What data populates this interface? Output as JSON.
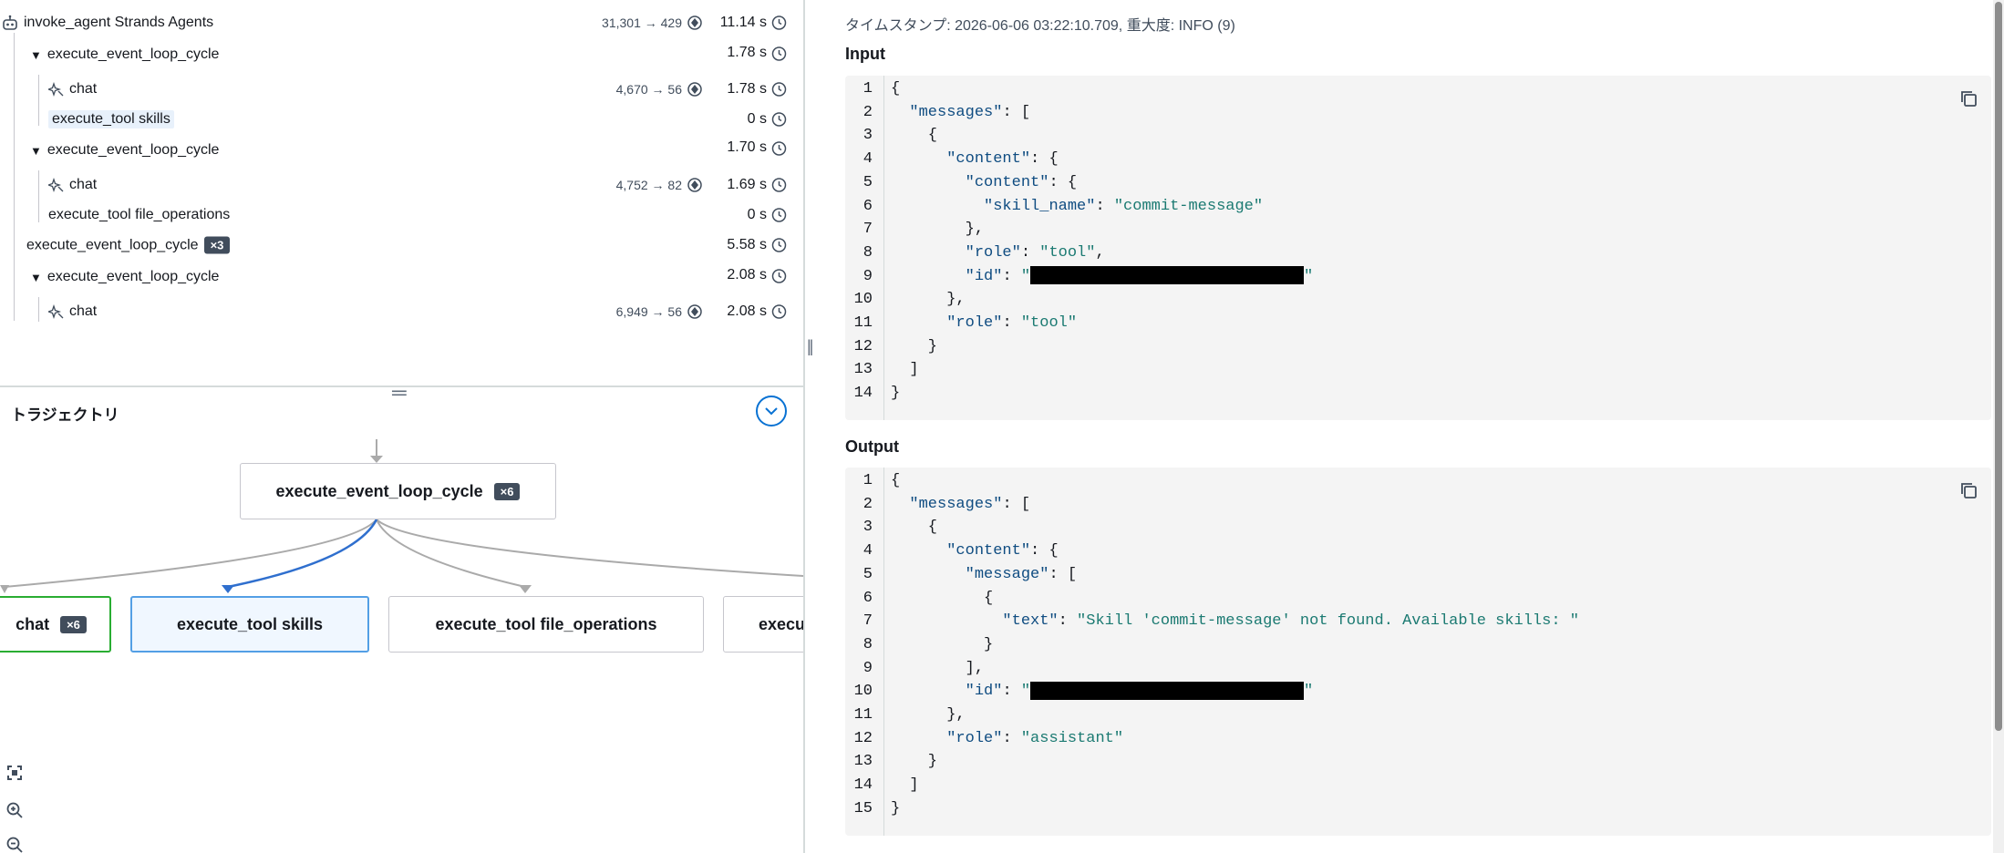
{
  "trace": {
    "rows": [
      {
        "label": "invoke_agent Strands Agents",
        "tokens": "31,301 → 429",
        "duration": "11.14 s"
      },
      {
        "label": "execute_event_loop_cycle",
        "duration": "1.78 s"
      },
      {
        "label": "chat",
        "tokens": "4,670 → 56",
        "duration": "1.78 s"
      },
      {
        "label": "execute_tool skills",
        "duration": "0 s"
      },
      {
        "label": "execute_event_loop_cycle",
        "duration": "1.70 s"
      },
      {
        "label": "chat",
        "tokens": "4,752 → 82",
        "duration": "1.69 s"
      },
      {
        "label": "execute_tool file_operations",
        "duration": "0 s"
      },
      {
        "label": "execute_event_loop_cycle",
        "badge": "×3",
        "duration": "5.58 s"
      },
      {
        "label": "execute_event_loop_cycle",
        "duration": "2.08 s"
      },
      {
        "label": "chat",
        "tokens": "6,949 → 56",
        "duration": "2.08 s"
      }
    ]
  },
  "trajectory": {
    "title": "トラジェクトリ",
    "root": {
      "label": "execute_event_loop_cycle",
      "badge": "×6"
    },
    "children": [
      {
        "label": "chat",
        "badge": "×6"
      },
      {
        "label": "execute_tool skills"
      },
      {
        "label": "execute_tool file_operations"
      },
      {
        "label": "execu"
      }
    ]
  },
  "detail": {
    "timestamp": "タイムスタンプ: 2026-06-06 03:22:10.709, 重大度: INFO (9)",
    "input_title": "Input",
    "output_title": "Output"
  },
  "input_code": [
    {
      "n": "1",
      "parts": [
        {
          "t": "p",
          "v": "{"
        }
      ]
    },
    {
      "n": "2",
      "parts": [
        {
          "t": "p",
          "v": "  "
        },
        {
          "t": "k",
          "v": "\"messages\""
        },
        {
          "t": "p",
          "v": ": ["
        }
      ]
    },
    {
      "n": "3",
      "parts": [
        {
          "t": "p",
          "v": "    {"
        }
      ]
    },
    {
      "n": "4",
      "parts": [
        {
          "t": "p",
          "v": "      "
        },
        {
          "t": "k",
          "v": "\"content\""
        },
        {
          "t": "p",
          "v": ": {"
        }
      ]
    },
    {
      "n": "5",
      "parts": [
        {
          "t": "p",
          "v": "        "
        },
        {
          "t": "k",
          "v": "\"content\""
        },
        {
          "t": "p",
          "v": ": {"
        }
      ]
    },
    {
      "n": "6",
      "parts": [
        {
          "t": "p",
          "v": "          "
        },
        {
          "t": "k",
          "v": "\"skill_name\""
        },
        {
          "t": "p",
          "v": ": "
        },
        {
          "t": "s",
          "v": "\"commit-message\""
        }
      ]
    },
    {
      "n": "7",
      "parts": [
        {
          "t": "p",
          "v": "        },"
        }
      ]
    },
    {
      "n": "8",
      "parts": [
        {
          "t": "p",
          "v": "        "
        },
        {
          "t": "k",
          "v": "\"role\""
        },
        {
          "t": "p",
          "v": ": "
        },
        {
          "t": "s",
          "v": "\"tool\""
        },
        {
          "t": "p",
          "v": ","
        }
      ]
    },
    {
      "n": "9",
      "parts": [
        {
          "t": "p",
          "v": "        "
        },
        {
          "t": "k",
          "v": "\"id\""
        },
        {
          "t": "p",
          "v": ": "
        },
        {
          "t": "s",
          "v": "\""
        },
        {
          "t": "r",
          "v": ""
        },
        {
          "t": "s",
          "v": "\""
        }
      ]
    },
    {
      "n": "10",
      "parts": [
        {
          "t": "p",
          "v": "      },"
        }
      ]
    },
    {
      "n": "11",
      "parts": [
        {
          "t": "p",
          "v": "      "
        },
        {
          "t": "k",
          "v": "\"role\""
        },
        {
          "t": "p",
          "v": ": "
        },
        {
          "t": "s",
          "v": "\"tool\""
        }
      ]
    },
    {
      "n": "12",
      "parts": [
        {
          "t": "p",
          "v": "    }"
        }
      ]
    },
    {
      "n": "13",
      "parts": [
        {
          "t": "p",
          "v": "  ]"
        }
      ]
    },
    {
      "n": "14",
      "parts": [
        {
          "t": "p",
          "v": "}"
        }
      ]
    }
  ],
  "output_code": [
    {
      "n": "1",
      "parts": [
        {
          "t": "p",
          "v": "{"
        }
      ]
    },
    {
      "n": "2",
      "parts": [
        {
          "t": "p",
          "v": "  "
        },
        {
          "t": "k",
          "v": "\"messages\""
        },
        {
          "t": "p",
          "v": ": ["
        }
      ]
    },
    {
      "n": "3",
      "parts": [
        {
          "t": "p",
          "v": "    {"
        }
      ]
    },
    {
      "n": "4",
      "parts": [
        {
          "t": "p",
          "v": "      "
        },
        {
          "t": "k",
          "v": "\"content\""
        },
        {
          "t": "p",
          "v": ": {"
        }
      ]
    },
    {
      "n": "5",
      "parts": [
        {
          "t": "p",
          "v": "        "
        },
        {
          "t": "k",
          "v": "\"message\""
        },
        {
          "t": "p",
          "v": ": ["
        }
      ]
    },
    {
      "n": "6",
      "parts": [
        {
          "t": "p",
          "v": "          {"
        }
      ]
    },
    {
      "n": "7",
      "parts": [
        {
          "t": "p",
          "v": "            "
        },
        {
          "t": "k",
          "v": "\"text\""
        },
        {
          "t": "p",
          "v": ": "
        },
        {
          "t": "s",
          "v": "\"Skill 'commit-message' not found. Available skills: \""
        }
      ]
    },
    {
      "n": "8",
      "parts": [
        {
          "t": "p",
          "v": "          }"
        }
      ]
    },
    {
      "n": "9",
      "parts": [
        {
          "t": "p",
          "v": "        ],"
        }
      ]
    },
    {
      "n": "10",
      "parts": [
        {
          "t": "p",
          "v": "        "
        },
        {
          "t": "k",
          "v": "\"id\""
        },
        {
          "t": "p",
          "v": ": "
        },
        {
          "t": "s",
          "v": "\""
        },
        {
          "t": "r",
          "v": ""
        },
        {
          "t": "s",
          "v": "\""
        }
      ]
    },
    {
      "n": "11",
      "parts": [
        {
          "t": "p",
          "v": "      },"
        }
      ]
    },
    {
      "n": "12",
      "parts": [
        {
          "t": "p",
          "v": "      "
        },
        {
          "t": "k",
          "v": "\"role\""
        },
        {
          "t": "p",
          "v": ": "
        },
        {
          "t": "s",
          "v": "\"assistant\""
        }
      ]
    },
    {
      "n": "13",
      "parts": [
        {
          "t": "p",
          "v": "    }"
        }
      ]
    },
    {
      "n": "14",
      "parts": [
        {
          "t": "p",
          "v": "  ]"
        }
      ]
    },
    {
      "n": "15",
      "parts": [
        {
          "t": "p",
          "v": "}"
        }
      ]
    }
  ],
  "colors": {
    "accent": "#0972d3",
    "selected_border": "#539fe5",
    "green_border": "#29ad32",
    "badge": "#414d5c",
    "edge_blue": "#2f6fce",
    "edge_gray": "#aaaaaa"
  }
}
